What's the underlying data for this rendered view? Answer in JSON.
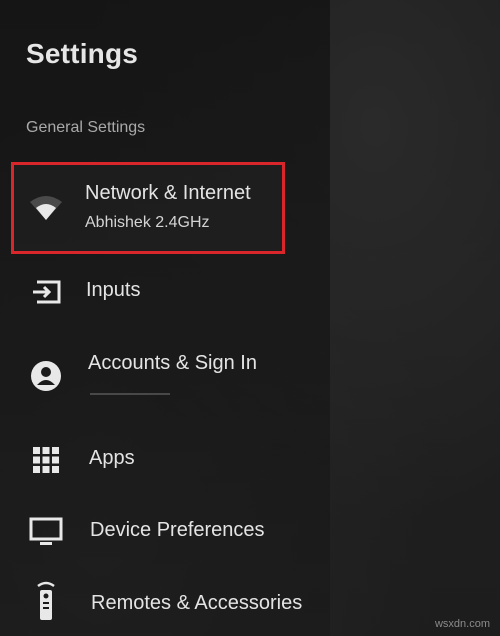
{
  "header": {
    "title": "Settings"
  },
  "section": {
    "label": "General Settings"
  },
  "items": [
    {
      "label": "Network & Internet",
      "sublabel": "Abhishek 2.4GHz",
      "icon": "wifi-icon",
      "selected": true
    },
    {
      "label": "Inputs",
      "icon": "input-icon"
    },
    {
      "label": "Accounts & Sign In",
      "icon": "account-circle-icon"
    },
    {
      "label": "Apps",
      "icon": "apps-grid-icon"
    },
    {
      "label": "Device Preferences",
      "icon": "monitor-icon"
    },
    {
      "label": "Remotes & Accessories",
      "icon": "remote-icon"
    }
  ],
  "watermark": "wsxdn.com",
  "colors": {
    "highlight": "#d8262b",
    "text": "#e4e4e4",
    "background": "#1b1b1b"
  }
}
